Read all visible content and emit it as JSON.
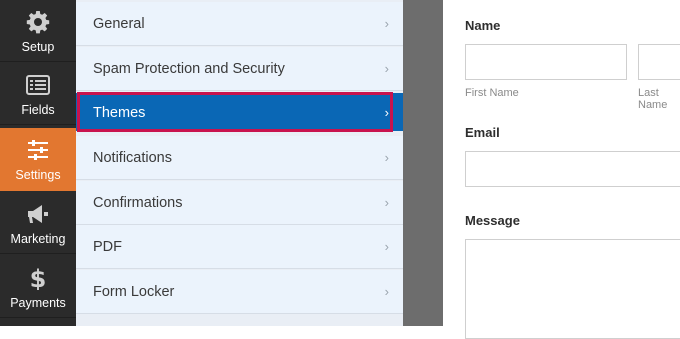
{
  "sidebar": {
    "items": [
      {
        "label": "Setup",
        "icon": "gear-icon"
      },
      {
        "label": "Fields",
        "icon": "list-icon"
      },
      {
        "label": "Settings",
        "icon": "sliders-icon",
        "active": true
      },
      {
        "label": "Marketing",
        "icon": "megaphone-icon"
      },
      {
        "label": "Payments",
        "icon": "dollar-icon"
      }
    ]
  },
  "settings_menu": {
    "items": [
      {
        "label": "General"
      },
      {
        "label": "Spam Protection and Security"
      },
      {
        "label": "Themes",
        "active": true
      },
      {
        "label": "Notifications"
      },
      {
        "label": "Confirmations"
      },
      {
        "label": "PDF"
      },
      {
        "label": "Form Locker"
      }
    ],
    "chevron": "›"
  },
  "form_preview": {
    "name_label": "Name",
    "first_name_sublabel": "First Name",
    "last_name_sublabel": "Last Name",
    "email_label": "Email",
    "message_label": "Message"
  },
  "colors": {
    "sidebar_bg": "#2b2b2b",
    "sidebar_active": "#e27730",
    "menu_active": "#0a67b5",
    "highlight_border": "#c8134e"
  }
}
